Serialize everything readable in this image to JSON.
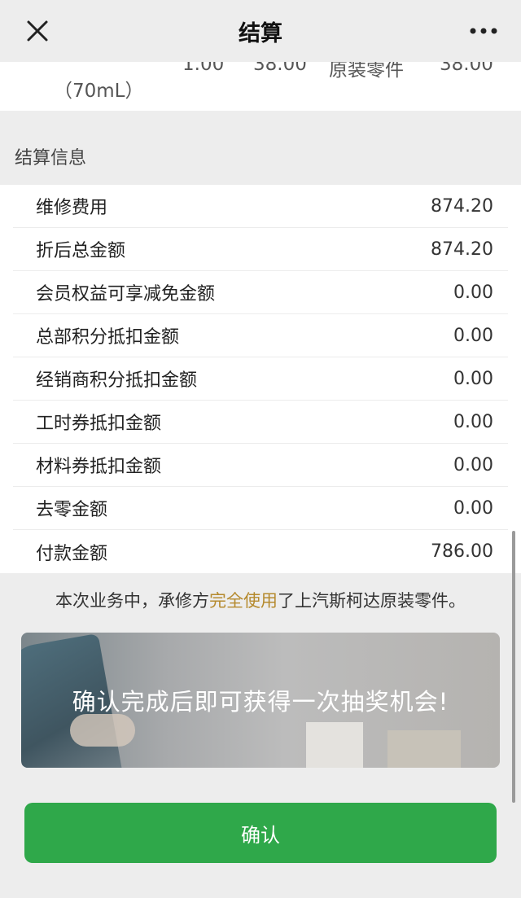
{
  "nav": {
    "title": "结算",
    "close_icon": "close-icon",
    "more_icon": "more-icon"
  },
  "part": {
    "name_tail": "（70mL）",
    "quantity": "1.00",
    "unit_price": "38.00",
    "type": "原装零件",
    "amount": "38.00"
  },
  "section_title": "结算信息",
  "rows": [
    {
      "label": "维修费用",
      "value": "874.20"
    },
    {
      "label": "折后总金额",
      "value": "874.20"
    },
    {
      "label": "会员权益可享减免金额",
      "value": "0.00"
    },
    {
      "label": "总部积分抵扣金额",
      "value": "0.00"
    },
    {
      "label": "经销商积分抵扣金额",
      "value": "0.00"
    },
    {
      "label": "工时券抵扣金额",
      "value": "0.00"
    },
    {
      "label": "材料券抵扣金额",
      "value": "0.00"
    },
    {
      "label": "去零金额",
      "value": "0.00"
    },
    {
      "label": "付款金额",
      "value": "786.00"
    }
  ],
  "notice": {
    "prefix": "本次业务中，承修方",
    "highlight": "完全使用",
    "suffix": "了上汽斯柯达原装零件。"
  },
  "banner_text": "确认完成后即可获得一次抽奖机会!",
  "confirm_label": "确认",
  "colors": {
    "accent": "#2fa84a",
    "highlight": "#b58a2e"
  }
}
